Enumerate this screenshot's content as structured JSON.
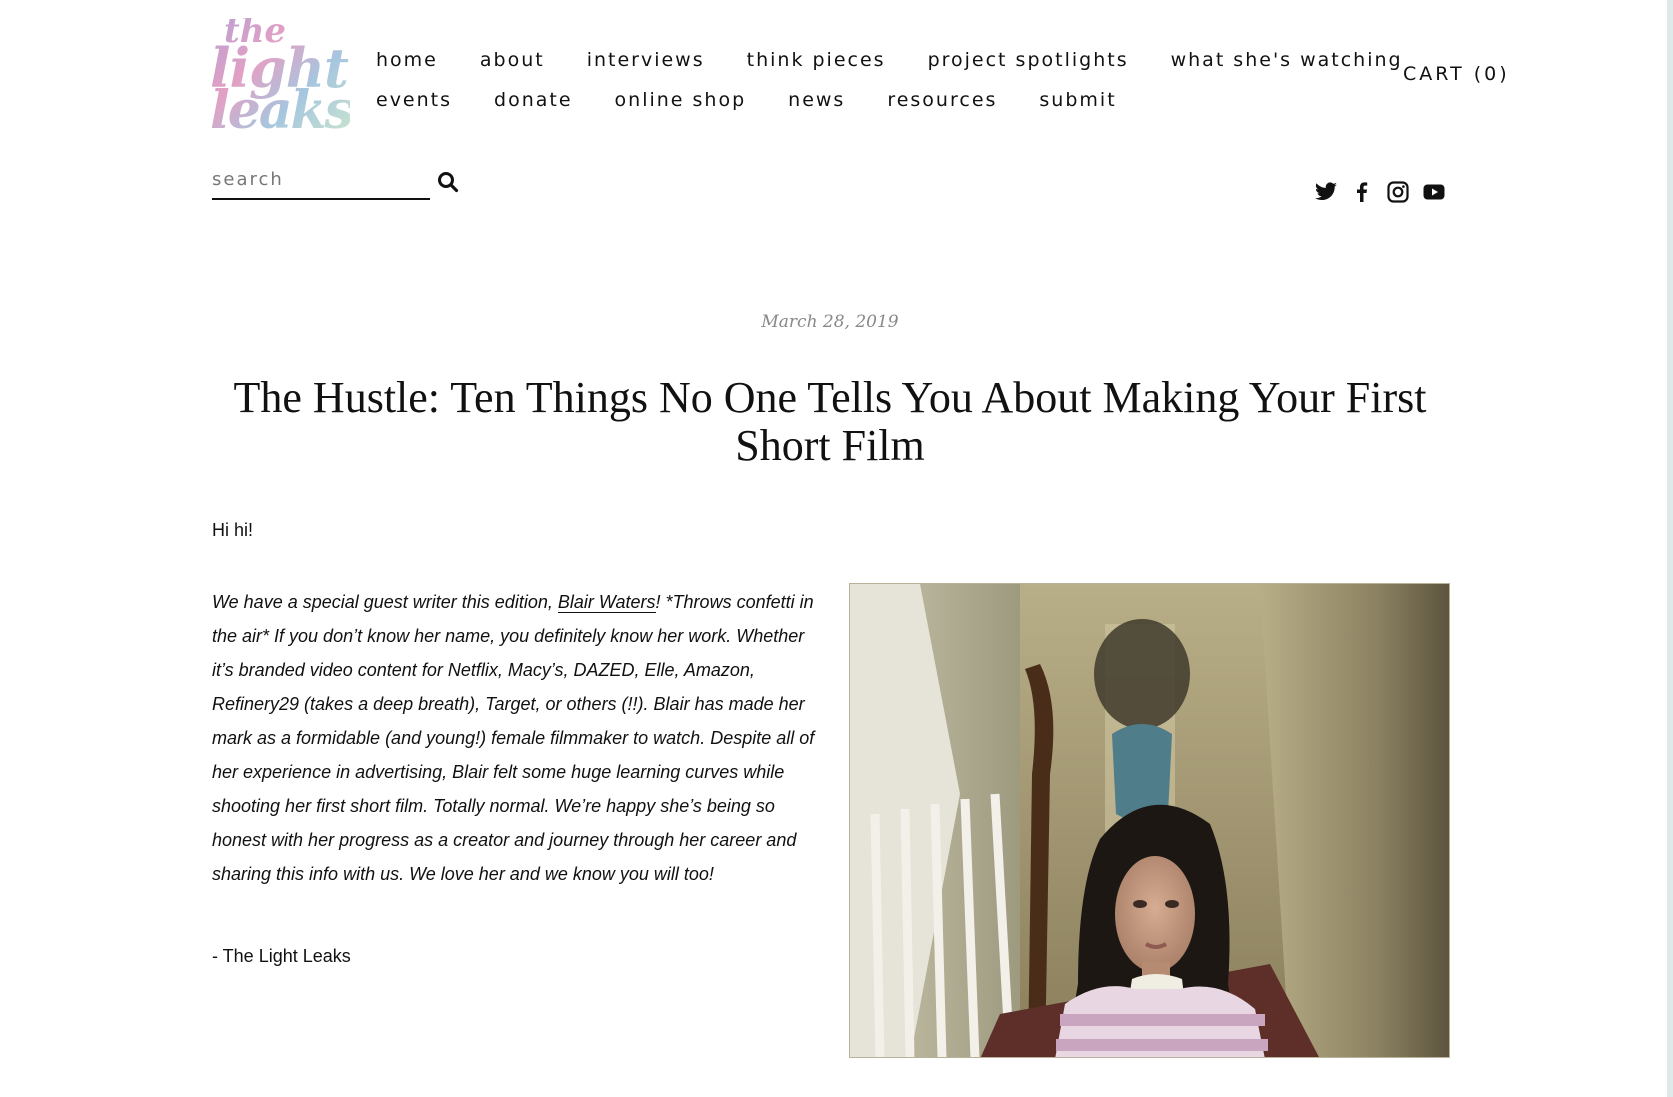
{
  "logo": {
    "line1": "the",
    "line2": "light",
    "line3": "leaks"
  },
  "nav": {
    "row1": [
      "home",
      "about",
      "interviews",
      "think pieces",
      "project spotlights",
      "what she's watching"
    ],
    "row2": [
      "events",
      "donate",
      "online shop",
      "news",
      "resources",
      "submit"
    ]
  },
  "cart": {
    "label": "CART (0)"
  },
  "search": {
    "placeholder": "search",
    "icon": "search-icon"
  },
  "social": [
    "twitter-icon",
    "facebook-icon",
    "instagram-icon",
    "youtube-icon"
  ],
  "article": {
    "date": "March 28, 2019",
    "title": "The Hustle: Ten Things No One Tells You About Making Your First Short Film",
    "greeting": "Hi hi!",
    "intro_before_link": "We have a special guest writer this edition, ",
    "intro_link": "Blair Waters",
    "intro_after_link": "! *Throws confetti in the air* If you don’t know her name, you definitely know her work. Whether it’s branded video content for Netflix, Macy’s, DAZED, Elle, Amazon, Refinery29 (takes a deep breath), Target, or others (!!). Blair has made her mark as a formidable (and young!) female filmmaker to watch. Despite all of her experience in advertising, Blair felt some huge learning curves while shooting her first short film. Totally normal. We’re happy she’s being so honest with her progress as a creator and journey through her career and sharing this info with us. We love her and we know you will too!",
    "signoff": "- The Light Leaks"
  },
  "colors": {
    "text": "#111111",
    "date": "#888888",
    "logo_gradient": [
      "#b9a0d2",
      "#e3a0c4",
      "#a6c6df",
      "#c9e4cf"
    ]
  }
}
